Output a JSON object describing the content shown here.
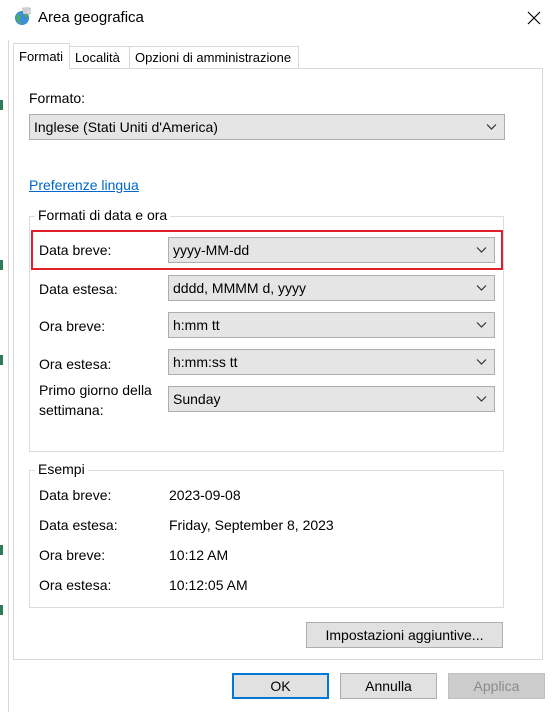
{
  "window": {
    "title": "Area geografica"
  },
  "tabs": [
    {
      "label": "Formati",
      "active": true
    },
    {
      "label": "Località",
      "active": false
    },
    {
      "label": "Opzioni di amministrazione",
      "active": false
    }
  ],
  "format": {
    "label": "Formato:",
    "value": "Inglese (Stati Uniti d'America)"
  },
  "language_link": "Preferenze lingua",
  "date_time_formats": {
    "title": "Formati di data e ora",
    "short_date": {
      "label": "Data breve:",
      "value": "yyyy-MM-dd"
    },
    "long_date": {
      "label": "Data estesa:",
      "value": "dddd, MMMM d, yyyy"
    },
    "short_time": {
      "label": "Ora breve:",
      "value": "h:mm tt"
    },
    "long_time": {
      "label": "Ora estesa:",
      "value": "h:mm:ss tt"
    },
    "first_day": {
      "label_line1": "Primo giorno della",
      "label_line2": "settimana:",
      "value": "Sunday"
    }
  },
  "examples": {
    "title": "Esempi",
    "short_date": {
      "label": "Data breve:",
      "value": "2023-09-08"
    },
    "long_date": {
      "label": "Data estesa:",
      "value": "Friday, September 8, 2023"
    },
    "short_time": {
      "label": "Ora breve:",
      "value": "10:12 AM"
    },
    "long_time": {
      "label": "Ora estesa:",
      "value": "10:12:05 AM"
    }
  },
  "buttons": {
    "additional_settings": "Impostazioni aggiuntive...",
    "ok": "OK",
    "cancel": "Annulla",
    "apply": "Applica"
  },
  "colors": {
    "highlight": "#e0202a",
    "link": "#0066cc",
    "primary_border": "#0078d7"
  }
}
